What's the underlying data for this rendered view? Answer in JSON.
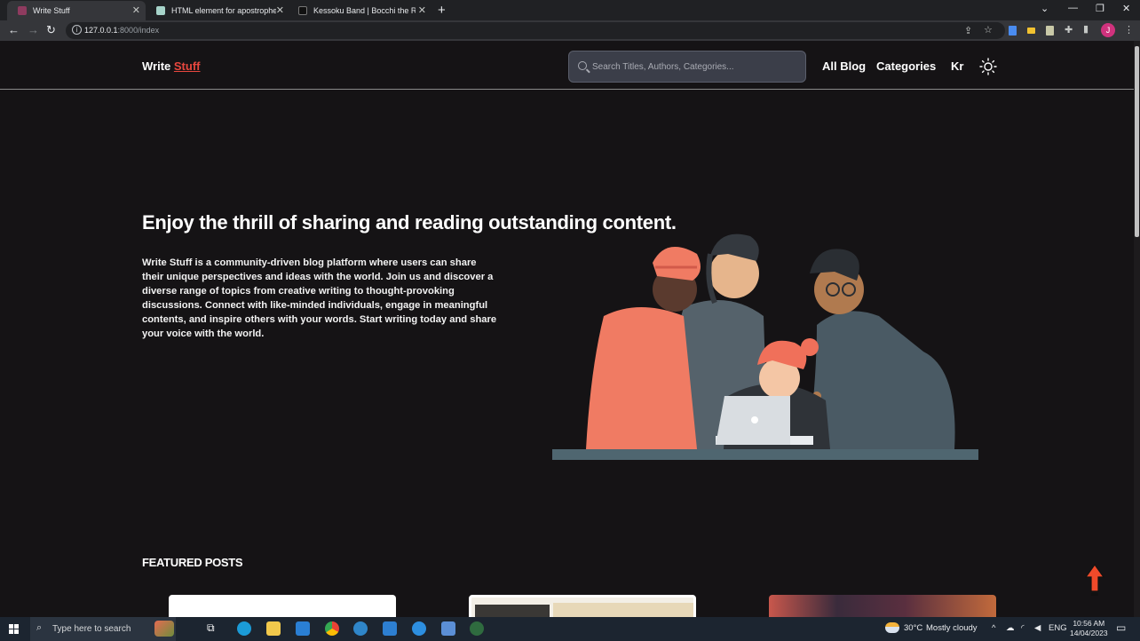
{
  "browser": {
    "tabs": [
      {
        "title": "Write Stuff",
        "active": true
      },
      {
        "title": "HTML element for apostrophe.",
        "active": false
      },
      {
        "title": "Kessoku Band | Bocchi the Rock!",
        "active": false
      }
    ],
    "url_host": "127.0.0.1",
    "url_path": ":8000/index",
    "profile_initial": "J"
  },
  "site": {
    "logo_main": "Write",
    "logo_accent": "Stuff",
    "search_placeholder": "Search Titles, Authors, Categories...",
    "nav": {
      "all_blog": "All Blog",
      "categories": "Categories",
      "user": "Kr"
    }
  },
  "hero": {
    "title": "Enjoy the thrill of sharing and reading outstanding content.",
    "text": "Write Stuff is a community-driven blog platform where users can share their unique perspectives and ideas with the world. Join us and discover a diverse range of topics from creative writing to thought-provoking discussions. Connect with like-minded individuals, engage in meaningful contents, and inspire others with your words. Start writing today and share your voice with the world."
  },
  "featured": {
    "heading": "FEATURED POSTS"
  },
  "taskbar": {
    "search_text": "Type here to search",
    "weather_temp": "30°C",
    "weather_desc": "Mostly cloudy",
    "lang": "ENG",
    "time": "10:56 AM",
    "date": "14/04/2023"
  },
  "colors": {
    "accent": "#e8473e",
    "background": "#151315"
  }
}
